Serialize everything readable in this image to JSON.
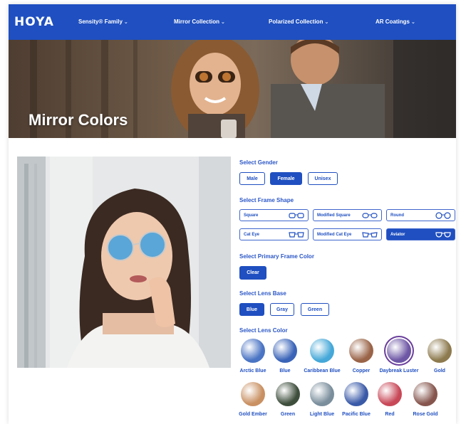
{
  "brand": {
    "logo": "HOYA"
  },
  "nav": {
    "items": [
      {
        "label": "Sensity® Family"
      },
      {
        "label": "Mirror Collection"
      },
      {
        "label": "Polarized Collection"
      },
      {
        "label": "AR Coatings"
      }
    ],
    "chevron": "⌄"
  },
  "hero": {
    "title": "Mirror Colors"
  },
  "gender": {
    "label": "Select Gender",
    "options": [
      "Male",
      "Female",
      "Unisex"
    ],
    "selected": "Female"
  },
  "frame_shape": {
    "label": "Select Frame Shape",
    "options": [
      "Square",
      "Modified Square",
      "Round",
      "Cat Eye",
      "Modified Cat Eye",
      "Aviator"
    ],
    "selected": "Aviator"
  },
  "frame_color": {
    "label": "Select Primary Frame Color",
    "options": [
      "Clear"
    ],
    "selected": "Clear"
  },
  "lens_base": {
    "label": "Select Lens Base",
    "options": [
      "Blue",
      "Gray",
      "Green"
    ],
    "selected": "Blue"
  },
  "lens_color": {
    "label": "Select Lens Color",
    "options": [
      {
        "name": "Arctic Blue",
        "color": "#4a74c4"
      },
      {
        "name": "Blue",
        "color": "#3a64b8"
      },
      {
        "name": "Caribbean Blue",
        "color": "#45a8d8"
      },
      {
        "name": "Copper",
        "color": "#9a6448"
      },
      {
        "name": "Daybreak Luster",
        "color": "#6e57a5"
      },
      {
        "name": "Gold",
        "color": "#8d7a4e"
      },
      {
        "name": "Gold Ember",
        "color": "#c99062"
      },
      {
        "name": "Green",
        "color": "#3e4e3c"
      },
      {
        "name": "Light Blue",
        "color": "#7a8e9c"
      },
      {
        "name": "Pacific Blue",
        "color": "#3a5aa8"
      },
      {
        "name": "Red",
        "color": "#c84858"
      },
      {
        "name": "Rose Gold",
        "color": "#86564e"
      }
    ],
    "selected": "Daybreak Luster"
  },
  "colors": {
    "primary": "#1f4fc0",
    "label_blue": "#2a56c6"
  }
}
